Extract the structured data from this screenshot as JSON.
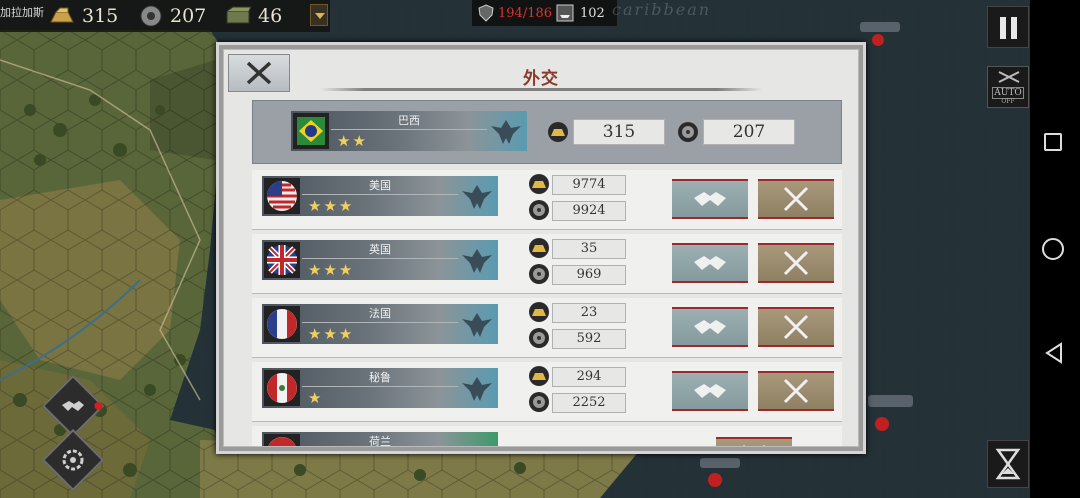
{
  "hud": {
    "clipped_text": "加拉加斯",
    "gold": "315",
    "industry": "207",
    "supply": "46",
    "army_count": "194/186",
    "ship_count": "102",
    "map_region_label": "caribbean"
  },
  "controls": {
    "auto_label": "AUTO",
    "auto_sub": "OFF"
  },
  "dialog": {
    "title": "外交",
    "self": {
      "name": "巴西",
      "stars": "★★",
      "gold": "315",
      "industry": "207"
    },
    "countries": [
      {
        "name": "美国",
        "stars": "★★★",
        "gold": "9774",
        "industry": "9924"
      },
      {
        "name": "英国",
        "stars": "★★★",
        "gold": "35",
        "industry": "969"
      },
      {
        "name": "法国",
        "stars": "★★★",
        "gold": "23",
        "industry": "592"
      },
      {
        "name": "秘鲁",
        "stars": "★",
        "gold": "294",
        "industry": "2252"
      },
      {
        "name": "荷兰",
        "stars": "",
        "gold": "",
        "industry": ""
      }
    ]
  },
  "colors": {
    "title": "#8a3a2a",
    "peace_button": "#9cb0b3",
    "war_button": "#a8987c",
    "star": "#f0d060",
    "army_red": "#e03030"
  }
}
